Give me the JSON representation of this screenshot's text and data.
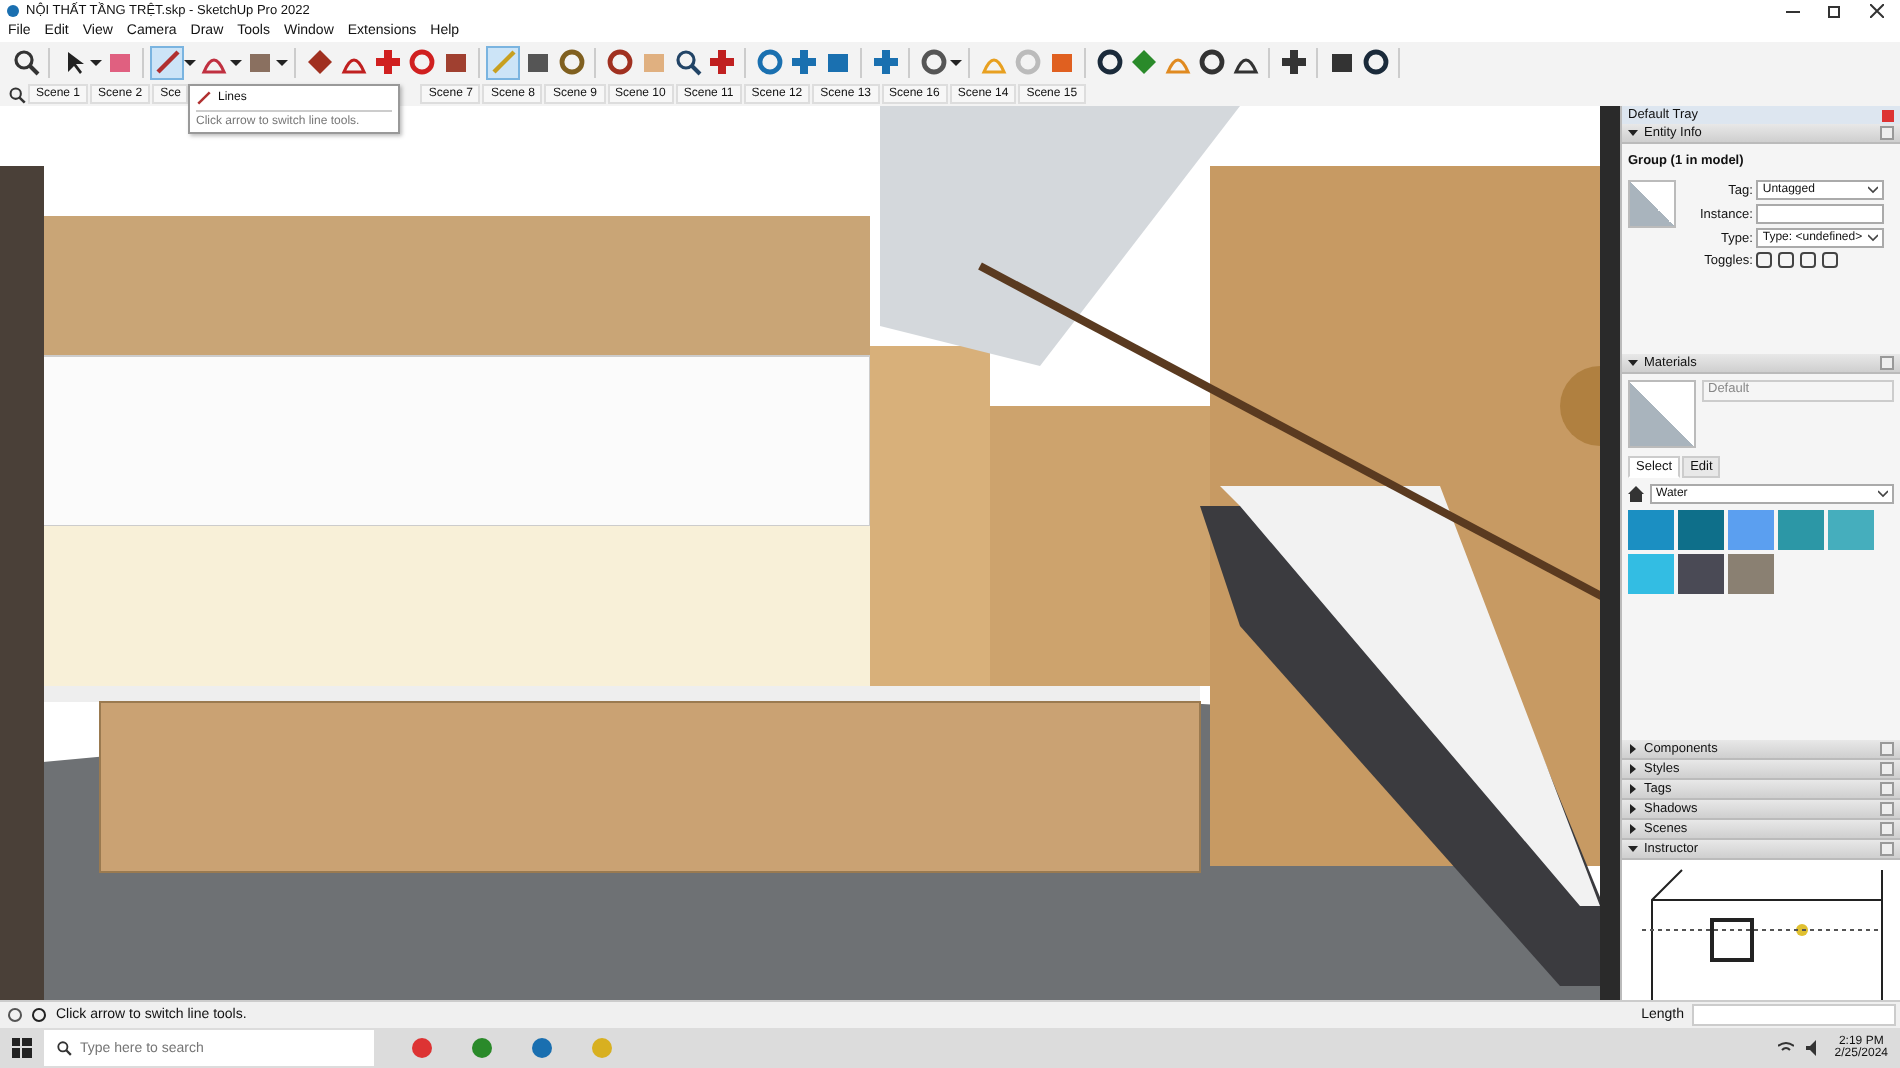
{
  "window": {
    "title": "NỘI THẤT TẦNG TRỆT.skp - SketchUp Pro 2022"
  },
  "menu": [
    "File",
    "Edit",
    "View",
    "Camera",
    "Draw",
    "Tools",
    "Window",
    "Extensions",
    "Help"
  ],
  "toolbar_buttons": [
    {
      "selected": false
    },
    {
      "selected": false
    },
    {
      "selected": false
    },
    {
      "selected": true
    },
    {
      "selected": false
    },
    {
      "selected": false
    },
    {
      "selected": false
    },
    {
      "selected": false
    },
    {
      "selected": false
    },
    {
      "selected": false
    },
    {
      "selected": false
    },
    {
      "selected": true
    },
    {
      "selected": false
    },
    {
      "selected": false
    },
    {
      "selected": false
    },
    {
      "selected": false
    },
    {
      "selected": false
    },
    {
      "selected": false
    },
    {
      "selected": false
    },
    {
      "selected": false
    },
    {
      "selected": false
    },
    {
      "selected": false
    },
    {
      "selected": false
    },
    {
      "selected": false
    },
    {
      "selected": false
    },
    {
      "selected": false
    },
    {
      "selected": false
    },
    {
      "selected": false
    },
    {
      "selected": false
    },
    {
      "selected": false
    },
    {
      "selected": false
    },
    {
      "selected": false
    },
    {
      "selected": false
    },
    {
      "selected": false
    }
  ],
  "scenes_before_tooltip": [
    "Scene 1",
    "Scene 2",
    "Sce"
  ],
  "scenes_after_tooltip": [
    "Scene 7",
    "Scene 8",
    "Scene 9",
    "Scene 10",
    "Scene 11",
    "Scene 12",
    "Scene 13",
    "Scene 16",
    "Scene 14",
    "Scene 15"
  ],
  "tooltip": {
    "title": "Lines",
    "hint": "Click arrow to switch line tools."
  },
  "tray": {
    "title": "Default Tray",
    "entity_info": {
      "title": "Entity Info",
      "expanded": true,
      "heading": "Group (1 in model)",
      "fields": [
        {
          "label": "Tag:",
          "value": "Untagged",
          "kind": "dropdown"
        },
        {
          "label": "Instance:",
          "kind": "text"
        },
        {
          "label": "Type:",
          "value": "Type: <undefined>",
          "kind": "dropdown"
        }
      ],
      "toggles_label": "Toggles:"
    },
    "materials": {
      "title": "Materials",
      "expanded": true,
      "material_name": "Default",
      "tabs": [
        {
          "label": "Select",
          "selected": true
        },
        {
          "label": "Edit",
          "selected": false
        }
      ],
      "library": "Water",
      "swatches": [
        {
          "color": "#1b8fc2"
        },
        {
          "color": "#0e6f8a"
        },
        {
          "color": "#5b9ff0"
        },
        {
          "color": "#2c97a6"
        },
        {
          "color": "#45aebd"
        },
        {
          "color": "#33bde3"
        },
        {
          "color": "#4a4a55"
        },
        {
          "color": "#8a8072"
        }
      ]
    },
    "panels": [
      {
        "title": "Components",
        "expanded": false
      },
      {
        "title": "Styles",
        "expanded": false
      },
      {
        "title": "Tags",
        "expanded": false
      },
      {
        "title": "Shadows",
        "expanded": false
      },
      {
        "title": "Scenes",
        "expanded": false
      },
      {
        "title": "Instructor",
        "expanded": true
      }
    ]
  },
  "status_bar": {
    "message": "Click arrow to switch line tools.",
    "measure_label": "Length"
  },
  "taskbar": {
    "search_placeholder": "Type here to search",
    "time": "2:19 PM",
    "date": "2/25/2024"
  }
}
